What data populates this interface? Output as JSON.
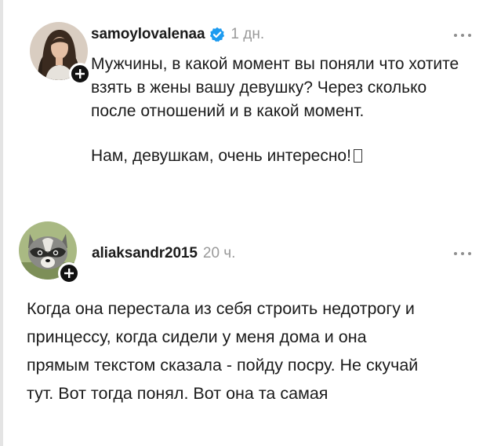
{
  "posts": [
    {
      "username": "samoylovalenaa",
      "verified": true,
      "time": "1 дн.",
      "avatar_icon": "woman-avatar",
      "badge_icon": "plus-icon",
      "more_icon": "more-dots-icon",
      "paragraphs": [
        "Мужчины, в какой момент вы поняли что хотите взять в жены вашу девушку? Через сколько после отношений и в какой момент.",
        "Нам, девушкам, очень интересно!"
      ],
      "emoji": "unsupported-emoji-box"
    },
    {
      "username": "aliaksandr2015",
      "verified": false,
      "time": "20 ч.",
      "avatar_icon": "raccoon-avatar",
      "badge_icon": "plus-icon",
      "more_icon": "more-dots-icon",
      "paragraphs": [
        "Когда она перестала из себя строить недотрогу и принцессу, когда сидели у меня дома и она прямым текстом сказала - пойду посру. Не скучай тут. Вот тогда понял. Вот она та самая"
      ]
    }
  ],
  "colors": {
    "text": "#1b1b1b",
    "muted": "#9a9a9a",
    "verified": "#1d9bf0",
    "badge": "#111111",
    "thread_line": "#e4e4e4"
  }
}
